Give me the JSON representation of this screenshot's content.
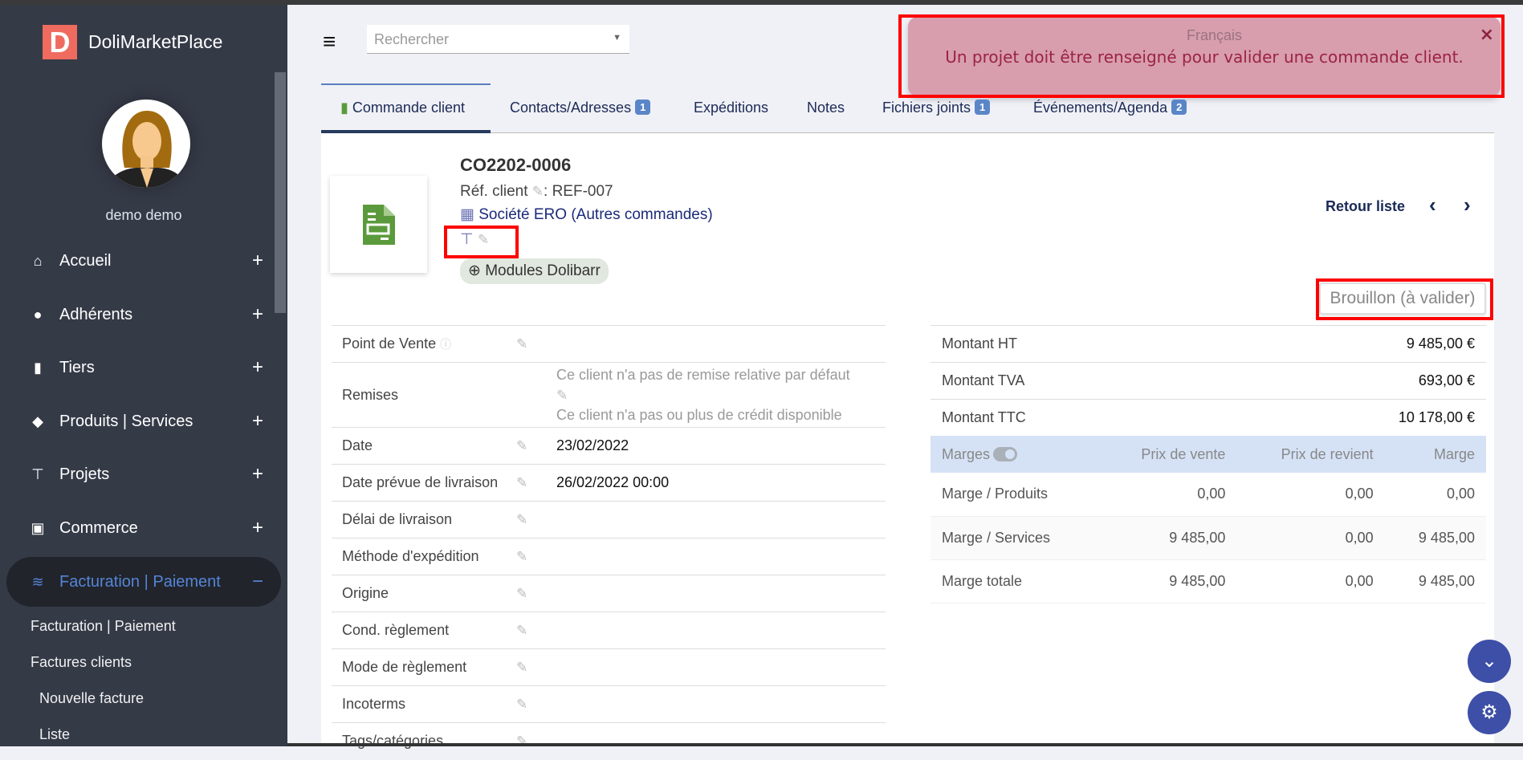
{
  "app": {
    "brand": "DoliMarketPlace",
    "logo_letter": "D",
    "user": "demo demo"
  },
  "sidebar": {
    "items": [
      {
        "label": "Accueil",
        "icon": "home-icon",
        "toggle": "+"
      },
      {
        "label": "Adhérents",
        "icon": "user-icon",
        "toggle": "+"
      },
      {
        "label": "Tiers",
        "icon": "building-icon",
        "toggle": "+"
      },
      {
        "label": "Produits | Services",
        "icon": "cube-icon",
        "toggle": "+"
      },
      {
        "label": "Projets",
        "icon": "sitemap-icon",
        "toggle": "+"
      },
      {
        "label": "Commerce",
        "icon": "briefcase-icon",
        "toggle": "+"
      },
      {
        "label": "Facturation | Paiement",
        "icon": "coins-icon",
        "toggle": "−"
      }
    ],
    "submenu": [
      "Facturation | Paiement",
      "Factures clients",
      "Nouvelle facture",
      "Liste"
    ]
  },
  "header": {
    "search_placeholder": "Rechercher",
    "language": "Français"
  },
  "toast": {
    "message": "Un projet doit être renseigné pour valider une commande client.",
    "close": "×"
  },
  "tabs": [
    {
      "label": "Commande client"
    },
    {
      "label": "Contacts/Adresses",
      "badge": "1"
    },
    {
      "label": "Expéditions"
    },
    {
      "label": "Notes"
    },
    {
      "label": "Fichiers joints",
      "badge": "1"
    },
    {
      "label": "Événements/Agenda",
      "badge": "2"
    }
  ],
  "order": {
    "ref": "CO2202-0006",
    "ref_client_label": "Réf. client",
    "ref_client": ": REF-007",
    "company": "Société ERO",
    "other_orders": "(Autres commandes)",
    "tag": "Modules Dolibarr",
    "back": "Retour liste",
    "prev": "‹",
    "next": "›",
    "status": "Brouillon (à valider)"
  },
  "fields": [
    {
      "label": "Point de Vente",
      "value": ""
    },
    {
      "label": "Remises",
      "value": "Ce client n'a pas de remise relative par défaut",
      "value2": "Ce client n'a pas ou plus de crédit disponible"
    },
    {
      "label": "Date",
      "value": "23/02/2022"
    },
    {
      "label": "Date prévue de livraison",
      "value": "26/02/2022 00:00"
    },
    {
      "label": "Délai de livraison",
      "value": ""
    },
    {
      "label": "Méthode d'expédition",
      "value": ""
    },
    {
      "label": "Origine",
      "value": ""
    },
    {
      "label": "Cond. règlement",
      "value": ""
    },
    {
      "label": "Mode de règlement",
      "value": ""
    },
    {
      "label": "Incoterms",
      "value": ""
    },
    {
      "label": "Tags/catégories",
      "value": ""
    }
  ],
  "totals": [
    {
      "label": "Montant HT",
      "value": "9 485,00 €"
    },
    {
      "label": "Montant TVA",
      "value": "693,00 €"
    },
    {
      "label": "Montant TTC",
      "value": "10 178,00 €"
    }
  ],
  "margins": {
    "headers": [
      "Marges",
      "Prix de vente",
      "Prix de revient",
      "Marge"
    ],
    "rows": [
      [
        "Marge / Produits",
        "0,00",
        "0,00",
        "0,00"
      ],
      [
        "Marge / Services",
        "9 485,00",
        "0,00",
        "9 485,00"
      ],
      [
        "Marge totale",
        "9 485,00",
        "0,00",
        "9 485,00"
      ]
    ]
  }
}
